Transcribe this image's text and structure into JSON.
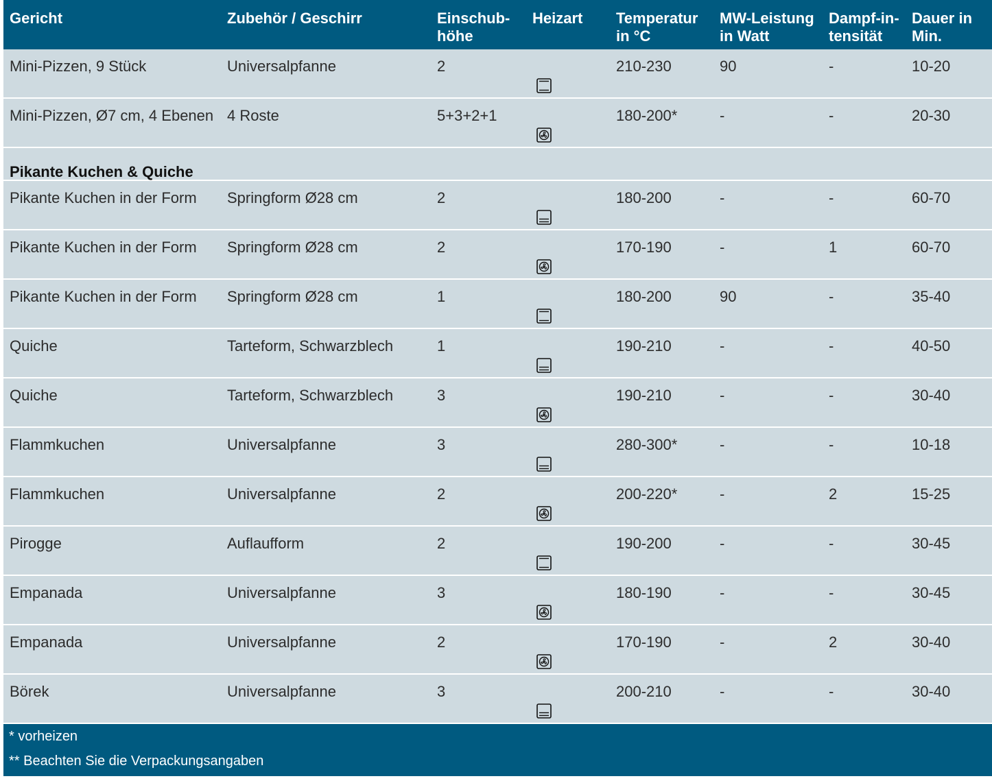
{
  "table": {
    "headers": [
      {
        "l1": "Gericht",
        "l2": ""
      },
      {
        "l1": "Zubehör / Geschirr",
        "l2": ""
      },
      {
        "l1": "Einschub-",
        "l2": "höhe"
      },
      {
        "l1": "Heizart",
        "l2": ""
      },
      {
        "l1": "Temperatur",
        "l2": "in °C"
      },
      {
        "l1": "MW-Leistung",
        "l2": "in Watt"
      },
      {
        "l1": "Dampf-in-",
        "l2": "tensität"
      },
      {
        "l1": "Dauer in",
        "l2": "Min."
      }
    ],
    "rows": [
      {
        "dish": "Mini-Pizzen, 9 Stück",
        "acc": "Universalpfanne",
        "level": "2",
        "heat": "top-bottom-heat-icon",
        "temp": "210-230",
        "mw": "90",
        "steam": "-",
        "dur": "10-20"
      },
      {
        "dish": "Mini-Pizzen, Ø7 cm, 4 Ebenen",
        "acc": "4 Roste",
        "level": "5+3+2+1",
        "heat": "fan-heat-icon",
        "temp": "180-200*",
        "mw": "-",
        "steam": "-",
        "dur": "20-30"
      },
      {
        "section": "Pikante Kuchen & Quiche"
      },
      {
        "dish": "Pikante Kuchen in der Form",
        "acc": "Springform Ø28 cm",
        "level": "2",
        "heat": "bottom-heat-fan-icon",
        "temp": "180-200",
        "mw": "-",
        "steam": "-",
        "dur": "60-70"
      },
      {
        "dish": "Pikante Kuchen in der Form",
        "acc": "Springform Ø28 cm",
        "level": "2",
        "heat": "fan-heat-icon",
        "temp": "170-190",
        "mw": "-",
        "steam": "1",
        "dur": "60-70"
      },
      {
        "dish": "Pikante Kuchen in der Form",
        "acc": "Springform Ø28 cm",
        "level": "1",
        "heat": "top-bottom-heat-icon",
        "temp": "180-200",
        "mw": "90",
        "steam": "-",
        "dur": "35-40"
      },
      {
        "dish": "Quiche",
        "acc": "Tarteform, Schwarzblech",
        "level": "1",
        "heat": "bottom-heat-fan-icon",
        "temp": "190-210",
        "mw": "-",
        "steam": "-",
        "dur": "40-50"
      },
      {
        "dish": "Quiche",
        "acc": "Tarteform, Schwarzblech",
        "level": "3",
        "heat": "fan-heat-icon",
        "temp": "190-210",
        "mw": "-",
        "steam": "-",
        "dur": "30-40"
      },
      {
        "dish": "Flammkuchen",
        "acc": "Universalpfanne",
        "level": "3",
        "heat": "bottom-heat-fan-icon",
        "temp": "280-300*",
        "mw": "-",
        "steam": "-",
        "dur": "10-18"
      },
      {
        "dish": "Flammkuchen",
        "acc": "Universalpfanne",
        "level": "2",
        "heat": "fan-heat-icon",
        "temp": "200-220*",
        "mw": "-",
        "steam": "2",
        "dur": "15-25"
      },
      {
        "dish": "Pirogge",
        "acc": "Auflaufform",
        "level": "2",
        "heat": "top-bottom-heat-icon",
        "temp": "190-200",
        "mw": "-",
        "steam": "-",
        "dur": "30-45"
      },
      {
        "dish": "Empanada",
        "acc": "Universalpfanne",
        "level": "3",
        "heat": "fan-heat-icon",
        "temp": "180-190",
        "mw": "-",
        "steam": "-",
        "dur": "30-45"
      },
      {
        "dish": "Empanada",
        "acc": "Universalpfanne",
        "level": "2",
        "heat": "fan-heat-icon",
        "temp": "170-190",
        "mw": "-",
        "steam": "2",
        "dur": "30-40"
      },
      {
        "dish": "Börek",
        "acc": "Universalpfanne",
        "level": "3",
        "heat": "bottom-heat-fan-icon",
        "temp": "200-210",
        "mw": "-",
        "steam": "-",
        "dur": "30-40"
      }
    ]
  },
  "footer": {
    "note1": "* vorheizen",
    "note2": "**  Beachten Sie die Verpackungsangaben"
  },
  "colors": {
    "header_bg": "#005a80",
    "row_bg": "#cedae0"
  }
}
